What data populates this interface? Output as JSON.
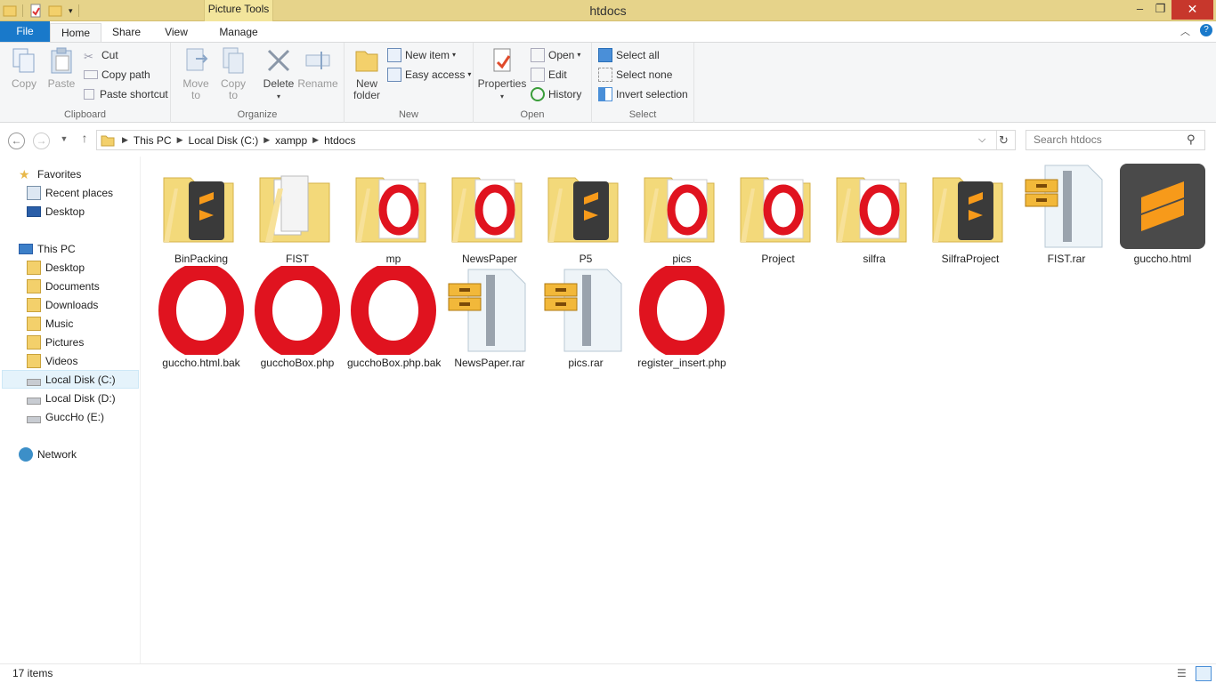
{
  "window": {
    "title": "htdocs",
    "context_tab": "Picture Tools",
    "minimize": "–",
    "maximize": "❐",
    "close": "✕"
  },
  "tabs": [
    "File",
    "Home",
    "Share",
    "View",
    "Manage"
  ],
  "ribbon": {
    "clipboard": {
      "label": "Clipboard",
      "copy": "Copy",
      "paste": "Paste",
      "cut": "Cut",
      "copy_path": "Copy path",
      "paste_shortcut": "Paste shortcut"
    },
    "organize": {
      "label": "Organize",
      "move_to_1": "Move",
      "move_to_2": "to",
      "copy_to_1": "Copy",
      "copy_to_2": "to",
      "delete": "Delete",
      "rename": "Rename"
    },
    "new": {
      "label": "New",
      "new_folder_1": "New",
      "new_folder_2": "folder",
      "new_item": "New item",
      "easy_access": "Easy access"
    },
    "open": {
      "label": "Open",
      "properties": "Properties",
      "open": "Open",
      "edit": "Edit",
      "history": "History"
    },
    "select": {
      "label": "Select",
      "select_all": "Select all",
      "select_none": "Select none",
      "invert": "Invert selection"
    }
  },
  "address": {
    "crumbs": [
      "This PC",
      "Local Disk (C:)",
      "xampp",
      "htdocs"
    ],
    "search_placeholder": "Search htdocs"
  },
  "sidebar": {
    "favorites": "Favorites",
    "recent": "Recent places",
    "desktop_fav": "Desktop",
    "this_pc": "This PC",
    "pc_items": [
      "Desktop",
      "Documents",
      "Downloads",
      "Music",
      "Pictures",
      "Videos",
      "Local Disk (C:)",
      "Local Disk (D:)",
      "GuccHo (E:)"
    ],
    "network": "Network"
  },
  "files": [
    {
      "name": "BinPacking",
      "kind": "folder-sublime"
    },
    {
      "name": "FIST",
      "kind": "folder-docs"
    },
    {
      "name": "mp",
      "kind": "folder-opera"
    },
    {
      "name": "NewsPaper",
      "kind": "folder-opera"
    },
    {
      "name": "P5",
      "kind": "folder-sublime"
    },
    {
      "name": "pics",
      "kind": "folder-opera"
    },
    {
      "name": "Project",
      "kind": "folder-opera"
    },
    {
      "name": "silfra",
      "kind": "folder-opera"
    },
    {
      "name": "SilfraProject",
      "kind": "folder-sublime"
    },
    {
      "name": "FIST.rar",
      "kind": "rar"
    },
    {
      "name": "guccho.html",
      "kind": "sublime"
    },
    {
      "name": "guccho.html.bak",
      "kind": "opera"
    },
    {
      "name": "gucchoBox.php",
      "kind": "opera"
    },
    {
      "name": "gucchoBox.php.bak",
      "kind": "opera"
    },
    {
      "name": "NewsPaper.rar",
      "kind": "rar"
    },
    {
      "name": "pics.rar",
      "kind": "rar"
    },
    {
      "name": "register_insert.php",
      "kind": "opera"
    }
  ],
  "status": {
    "count": "17 items"
  },
  "colors": {
    "file_tab": "#1979ca",
    "titlebar": "#e6d38a",
    "opera_red": "#e0131f",
    "folder": "#f3d97a",
    "sublime": "#f79a1a"
  }
}
